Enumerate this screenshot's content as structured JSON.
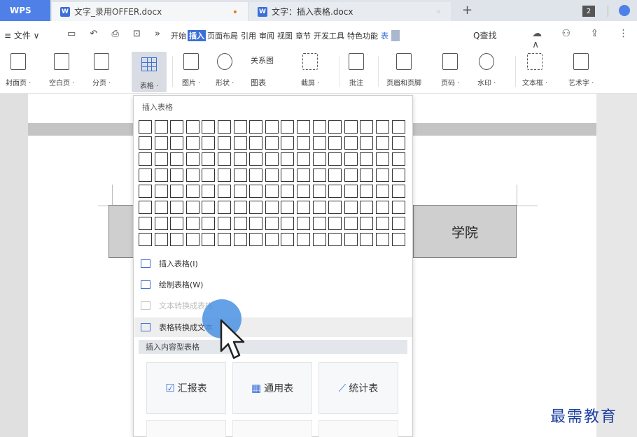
{
  "tabbar": {
    "app_name": "WPS",
    "tabs": [
      {
        "label": "文字_录用OFFER.docx",
        "icon": "W"
      },
      {
        "label": "文字：插入表格.docx",
        "icon": "W"
      }
    ],
    "add_label": "+",
    "window_count": "2"
  },
  "menubar": {
    "file_label": "≡ 文件 ∨",
    "quick_icons": "▭ ↶ ⎙ ⊡ »",
    "items": [
      "开始",
      "插入",
      "页面布局",
      "引用",
      "审阅",
      "视图",
      "章节",
      "开发工具",
      "特色功能",
      "表"
    ],
    "active_item": "插入",
    "search_label": "Q查找",
    "right_icons": "☁ ⚇ ⇪ ⋮ ∧"
  },
  "toolbar": {
    "buttons": [
      {
        "label": "封面页 ·"
      },
      {
        "label": "空白页 ·"
      },
      {
        "label": "分页 ·"
      },
      {
        "label": "表格 ·"
      },
      {
        "label": "图片 ·"
      },
      {
        "label": "形状 ·"
      },
      {
        "label": "截屏 ·"
      },
      {
        "label": "批注"
      },
      {
        "label": "页眉和页脚"
      },
      {
        "label": "页码 ·"
      },
      {
        "label": "水印 ·"
      },
      {
        "label": "文本框 ·"
      },
      {
        "label": "艺术字 ·"
      }
    ],
    "small_buttons": {
      "relation": "关系图",
      "chart": "图表"
    }
  },
  "dropdown": {
    "title": "插入表格",
    "grid": {
      "columns": 17,
      "rows": 8
    },
    "items": [
      {
        "label": "插入表格(I)",
        "enabled": true
      },
      {
        "label": "绘制表格(W)",
        "enabled": true
      },
      {
        "label": "文本转换成表格",
        "enabled": false
      },
      {
        "label": "表格转换成文本",
        "enabled": true
      }
    ],
    "section_title": "插入内容型表格",
    "cards": [
      {
        "label": "汇报表",
        "icon": "☑"
      },
      {
        "label": "通用表",
        "icon": "▦"
      },
      {
        "label": "统计表",
        "icon": "⟋"
      }
    ]
  },
  "document": {
    "cell_text": "学院"
  },
  "watermark": "最需教育"
}
